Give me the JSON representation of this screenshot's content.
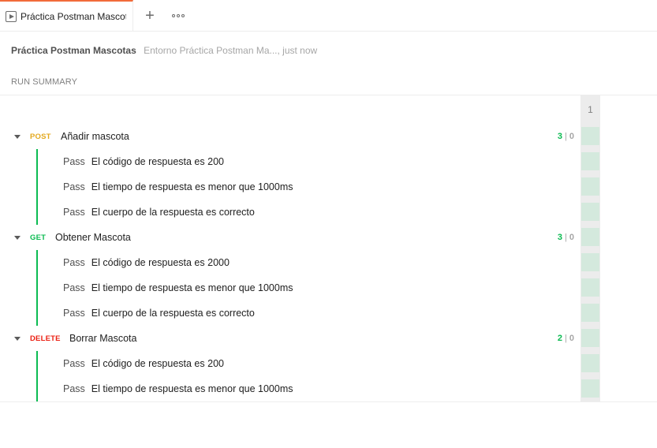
{
  "tab": {
    "title": "Práctica Postman Mascot",
    "icon": "runner-play-icon",
    "add_icon": "plus-icon",
    "more_icon": "more-options-icon"
  },
  "run": {
    "title": "Práctica Postman Mascotas",
    "meta": "Entorno Práctica Postman Ma..., just now"
  },
  "summary": {
    "label": "RUN SUMMARY",
    "iteration_header": "1"
  },
  "colors": {
    "accent": "#f26b3a",
    "pass": "#0cbb52",
    "post": "#e4a91f",
    "get": "#0cbb52",
    "delete": "#eb2013",
    "iteration_pass_cell": "#d4e9dd"
  },
  "requests": [
    {
      "method": "POST",
      "name": "Añadir mascota",
      "passed": "3",
      "failed": "0",
      "tests": [
        {
          "status": "Pass",
          "name": "El código de respuesta es 200"
        },
        {
          "status": "Pass",
          "name": "El tiempo de respuesta es menor que 1000ms"
        },
        {
          "status": "Pass",
          "name": "El cuerpo de la respuesta es correcto"
        }
      ]
    },
    {
      "method": "GET",
      "name": "Obtener Mascota",
      "passed": "3",
      "failed": "0",
      "tests": [
        {
          "status": "Pass",
          "name": "El código de respuesta es 2000"
        },
        {
          "status": "Pass",
          "name": "El tiempo de respuesta es menor que 1000ms"
        },
        {
          "status": "Pass",
          "name": "El cuerpo de la respuesta es correcto"
        }
      ]
    },
    {
      "method": "DELETE",
      "name": "Borrar Mascota",
      "passed": "2",
      "failed": "0",
      "tests": [
        {
          "status": "Pass",
          "name": "El código de respuesta es 200"
        },
        {
          "status": "Pass",
          "name": "El tiempo de respuesta es menor que 1000ms"
        }
      ]
    }
  ]
}
